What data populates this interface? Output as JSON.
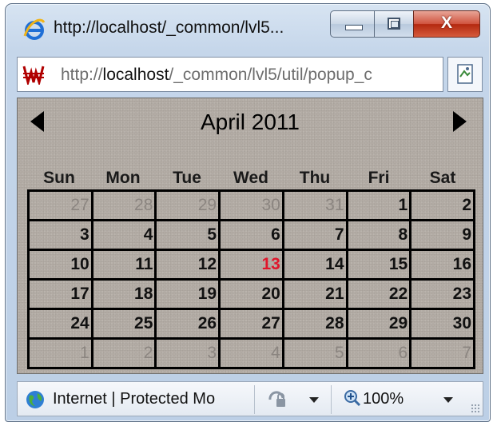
{
  "window": {
    "title": "http://localhost/_common/lvl5...",
    "close_glyph": "X"
  },
  "address": {
    "url_prefix": "http://",
    "url_host": "localhost",
    "url_path": "/_common/lvl5/util/popup_c"
  },
  "calendar": {
    "month_title": "April 2011",
    "weekdays": [
      "Sun",
      "Mon",
      "Tue",
      "Wed",
      "Thu",
      "Fri",
      "Sat"
    ],
    "weeks": [
      [
        "27",
        "28",
        "29",
        "30",
        "31",
        "1",
        "2"
      ],
      [
        "3",
        "4",
        "5",
        "6",
        "7",
        "8",
        "9"
      ],
      [
        "10",
        "11",
        "12",
        "13",
        "14",
        "15",
        "16"
      ],
      [
        "17",
        "18",
        "19",
        "20",
        "21",
        "22",
        "23"
      ],
      [
        "24",
        "25",
        "26",
        "27",
        "28",
        "29",
        "30"
      ],
      [
        "1",
        "2",
        "3",
        "4",
        "5",
        "6",
        "7"
      ]
    ],
    "today": "13",
    "today_color": "#e0162b",
    "other_month_color": "#8b8580"
  },
  "status": {
    "zone_text": "Internet | Protected Mo",
    "zoom": "100%"
  },
  "icons": {
    "title": "ie-logo-icon",
    "site": "site-favicon-icon",
    "page": "page-icon",
    "prev": "prev-month-arrow-icon",
    "next": "next-month-arrow-icon",
    "zone": "globe-icon",
    "security": "lock-icon",
    "zoom": "zoom-magnifier-icon"
  }
}
